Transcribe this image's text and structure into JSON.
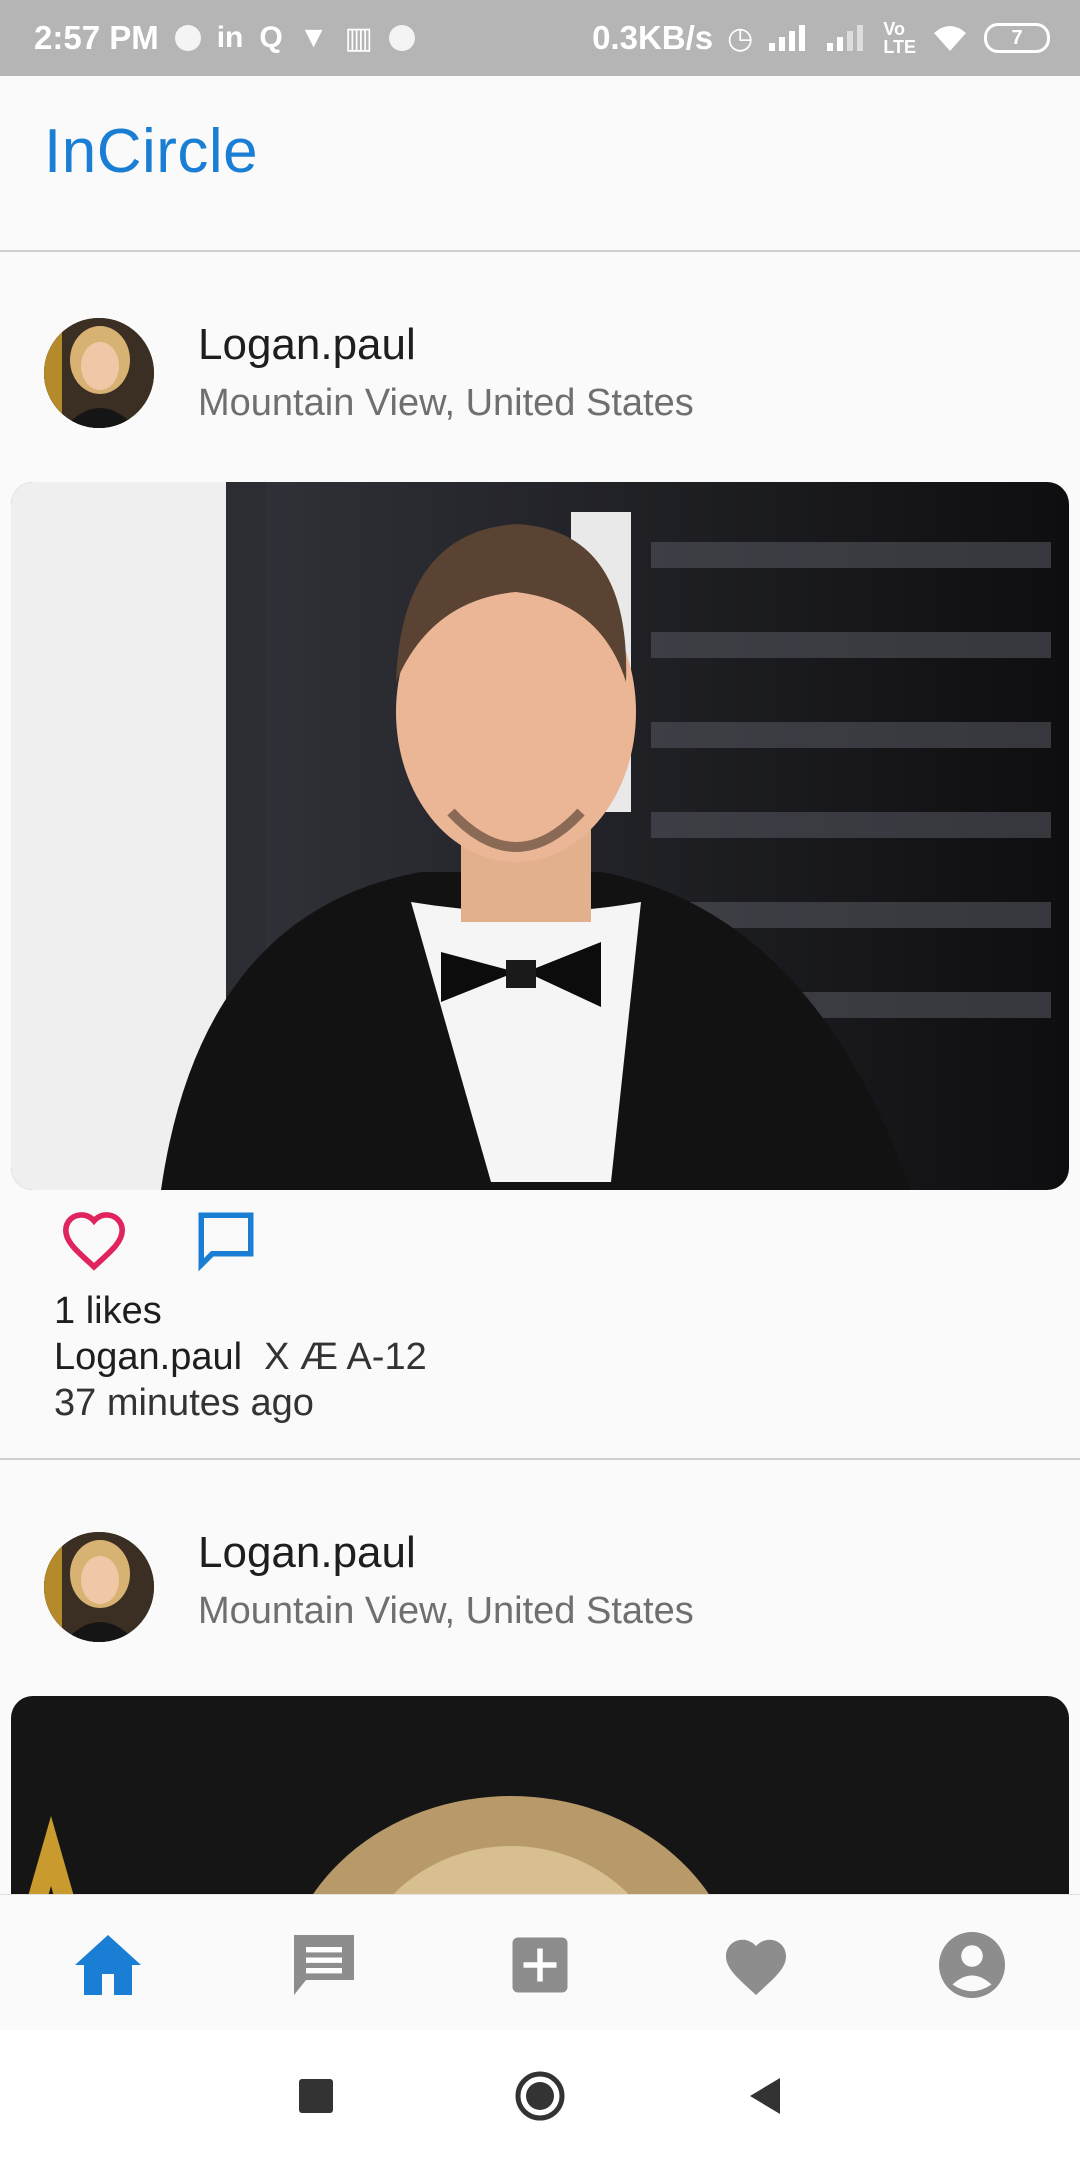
{
  "status_bar": {
    "time": "2:57 PM",
    "network_speed": "0.3KB/s",
    "battery": "7",
    "icons": [
      "linkedin-icon",
      "quora-icon",
      "book-icon",
      "trash-icon",
      "alarm-icon",
      "signal-icon",
      "volte-icon",
      "wifi-icon",
      "battery-icon"
    ]
  },
  "app": {
    "title": "InCircle",
    "accent_color": "#1a7fd4",
    "like_color": "#e0245e"
  },
  "posts": [
    {
      "username": "Logan.paul",
      "location": "Mountain View, United States",
      "likes": "1 likes",
      "caption_user": "Logan.paul",
      "caption_text": "X Æ A-12",
      "time_ago": "37 minutes ago"
    },
    {
      "username": "Logan.paul",
      "location": "Mountain View, United States"
    }
  ],
  "bottom_nav": {
    "items": [
      "home-icon",
      "chat-icon",
      "add-post-icon",
      "favorites-icon",
      "profile-icon"
    ],
    "active": "home-icon"
  },
  "system_nav": [
    "recents-icon",
    "home-circle-icon",
    "back-icon"
  ]
}
